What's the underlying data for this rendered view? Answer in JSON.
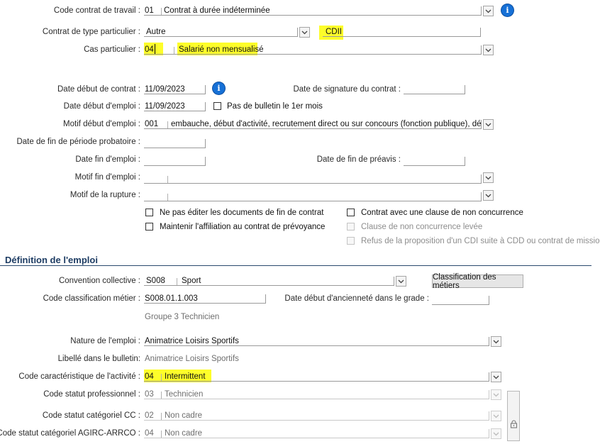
{
  "contract": {
    "code_contrat_label": "Code contrat de travail :",
    "code_contrat_code": "01",
    "code_contrat_value": "Contrat à durée indéterminée",
    "type_particulier_label": "Contrat de type particulier :",
    "type_particulier_value": "Autre",
    "type_particulier_extra": "CDII",
    "cas_particulier_label": "Cas particulier :",
    "cas_particulier_code": "04",
    "cas_particulier_value": "Salarié non mensualisé",
    "date_debut_contrat_label": "Date début de contrat :",
    "date_debut_contrat_value": "11/09/2023",
    "date_signature_label": "Date de signature du contrat :",
    "date_debut_emploi_label": "Date début d'emploi :",
    "date_debut_emploi_value": "11/09/2023",
    "pas_bulletin_label": "Pas de bulletin le 1er mois",
    "motif_debut_label": "Motif début d'emploi :",
    "motif_debut_code": "001",
    "motif_debut_value": "embauche, début d'activité, recrutement direct ou sur concours (fonction publique), début de c",
    "date_fin_probatoire_label": "Date de fin de période probatoire :",
    "date_fin_emploi_label": "Date fin d'emploi :",
    "date_fin_preavis_label": "Date de fin de préavis :",
    "motif_fin_label": "Motif fin d'emploi :",
    "motif_rupture_label": "Motif de la rupture :"
  },
  "checkboxes": {
    "ne_pas_editer": "Ne pas éditer les documents de fin de contrat",
    "maintenir_affiliation": "Maintenir l'affiliation au contrat de prévoyance",
    "clause_non_concurrence": "Contrat avec une clause de non concurrence",
    "clause_levee": "Clause de non concurrence levée",
    "refus_cdi": "Refus de la proposition d'un CDI suite à CDD ou contrat de mission"
  },
  "emploi": {
    "section_title": "Définition de l'emploi",
    "convention_label": "Convention collective :",
    "convention_code": "S008",
    "convention_value": "Sport",
    "classification_button": "Classification des métiers",
    "code_classif_label": "Code classification métier :",
    "code_classif_value": "S008.01.1.003",
    "date_anciennete_label": "Date début d'ancienneté dans le grade :",
    "groupe_text": "Groupe 3 Technicien",
    "nature_label": "Nature de l'emploi :",
    "nature_value": "Animatrice Loisirs Sportifs",
    "libelle_label": "Libellé dans le bulletin:",
    "libelle_value": "Animatrice Loisirs Sportifs",
    "code_activite_label": "Code caractéristique de l'activité :",
    "code_activite_code": "04",
    "code_activite_value": "Intermittent",
    "statut_pro_label": "Code statut professionnel :",
    "statut_pro_code": "03",
    "statut_pro_value": "Technicien",
    "statut_cc_label": "Code statut catégoriel CC :",
    "statut_cc_code": "02",
    "statut_cc_value": "Non cadre",
    "statut_agirc_label": "Code statut catégoriel AGIRC-ARRCO :",
    "statut_agirc_code": "04",
    "statut_agirc_value": "Non cadre"
  },
  "icons": {
    "info": "i",
    "chevron": "chevron-down-icon",
    "lock": "lock-icon"
  },
  "colors": {
    "highlight": "#fdfd2a",
    "info_blue": "#1670d6",
    "section_title": "#1d3c63"
  }
}
